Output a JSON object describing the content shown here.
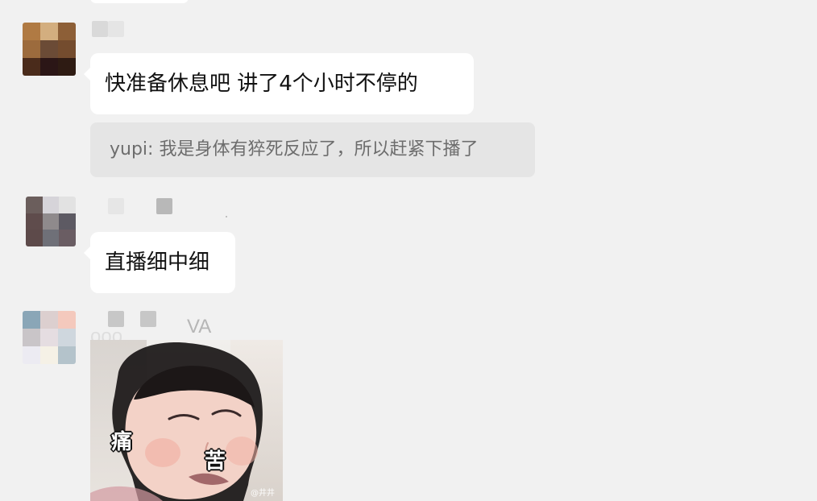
{
  "messages": [
    {
      "text": "快准备休息吧  讲了4个小时不停的",
      "quote": "yupi: 我是身体有猝死反应了，所以赶紧下播了"
    },
    {
      "text": "直播细中细"
    },
    {
      "sender_tail": "VA",
      "sticker": {
        "word_left": "痛",
        "word_right": "苦",
        "watermark": "@井井"
      }
    }
  ]
}
